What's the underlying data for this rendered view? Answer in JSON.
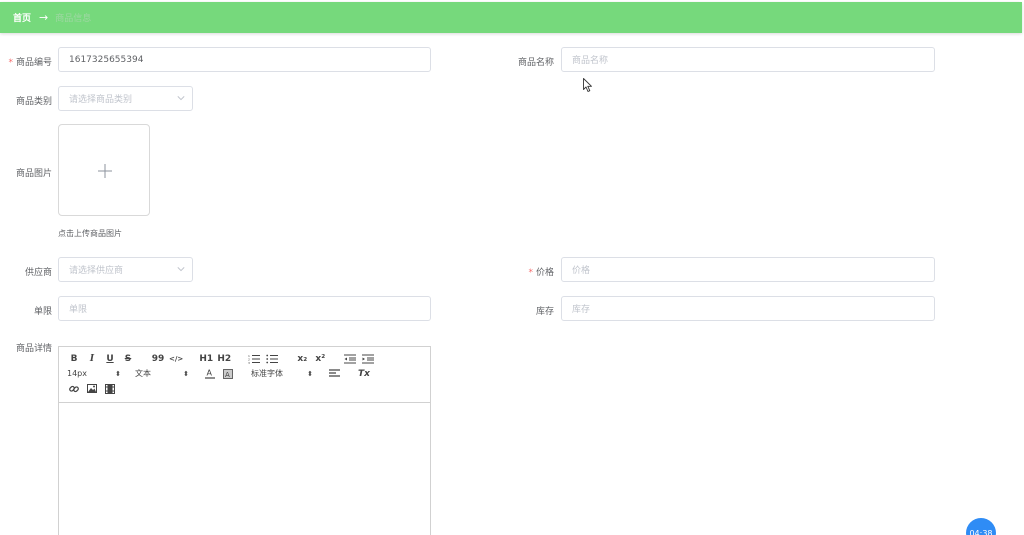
{
  "breadcrumb": {
    "home": "首页",
    "separator": "→",
    "current": "商品信息"
  },
  "form": {
    "code": {
      "label": "商品编号",
      "value": "1617325655394",
      "required": true
    },
    "name": {
      "label": "商品名称",
      "placeholder": "商品名称"
    },
    "category": {
      "label": "商品类别",
      "placeholder": "请选择商品类别"
    },
    "image": {
      "label": "商品图片",
      "tip": "点击上传商品图片"
    },
    "supplier": {
      "label": "供应商",
      "placeholder": "请选择供应商"
    },
    "price": {
      "label": "价格",
      "placeholder": "价格",
      "required": true
    },
    "unit": {
      "label": "单限",
      "placeholder": "单限"
    },
    "stock": {
      "label": "库存",
      "placeholder": "库存"
    },
    "detail": {
      "label": "商品详情"
    }
  },
  "editor": {
    "toolbar": {
      "bold": "B",
      "italic": "I",
      "underline": "U",
      "strike": "S",
      "quote": "99",
      "code": "</>",
      "h1": "H1",
      "h2": "H2",
      "sub": "x₂",
      "sup": "x²",
      "size": "14px",
      "header": "文本",
      "font": "标准字体",
      "clean": "Tx"
    }
  },
  "timer": {
    "text": "04:38"
  },
  "colors": {
    "topbar": "#76d97c",
    "required": "#f56c6c",
    "timer": "#2f8cf5"
  }
}
